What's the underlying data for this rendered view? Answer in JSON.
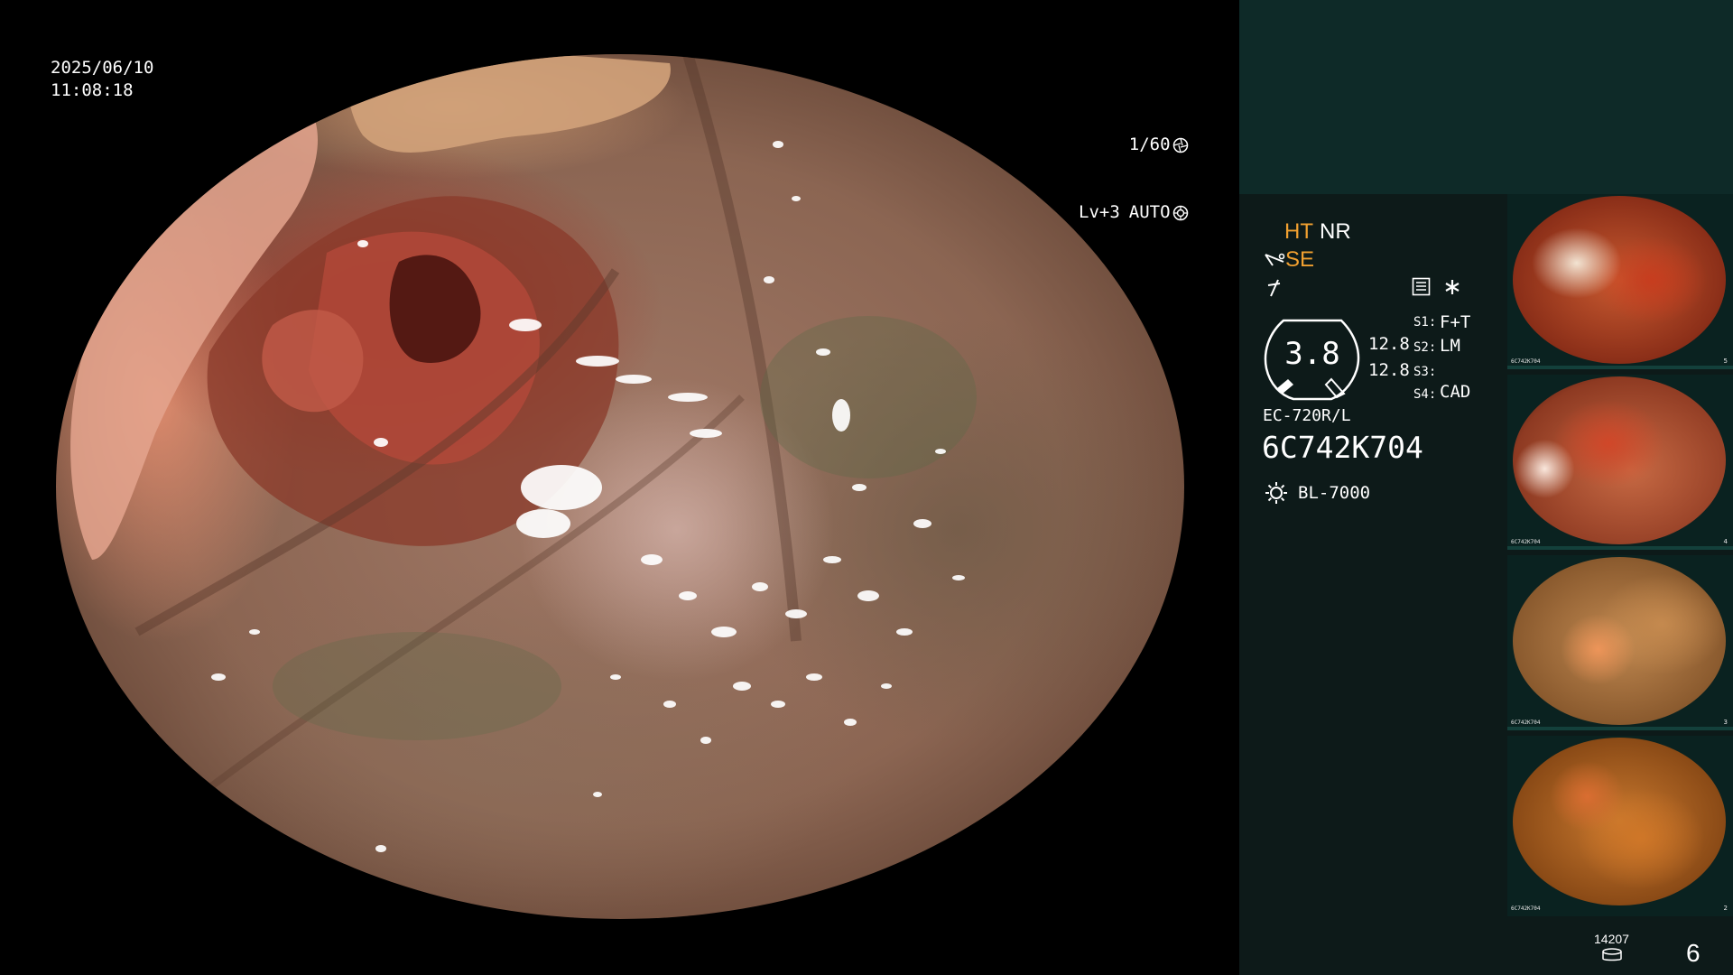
{
  "overlay": {
    "date": "2025/06/10",
    "time": "11:08:18",
    "shutter": "1/60",
    "level": "Lv+3",
    "mode": "AUTO"
  },
  "panel": {
    "ht": "HT",
    "nr": "NR",
    "se": "SE",
    "gauge_value": "3.8",
    "val1": "12.8",
    "val2": "12.8",
    "s1_label": "S1:",
    "s1_value": "F+T",
    "s2_label": "S2:",
    "s2_value": "LM",
    "s3_label": "S3:",
    "s3_value": "",
    "s4_label": "S4:",
    "s4_value": "CAD",
    "scope_model": "EC-720R/L",
    "scope_serial": "6C742K704",
    "light_source": "BL-7000",
    "image_count": "14207",
    "capture_number": "6"
  },
  "icons": {
    "shutter": "shutter-icon",
    "auto": "auto-iris-icon",
    "scissors": "scissors-icon",
    "lightning": "lightning-icon",
    "memo": "memo-icon",
    "asterisk": "asterisk-icon",
    "lamp": "lamp-icon",
    "disk": "disk-stack-icon"
  },
  "thumbnails": [
    {
      "serial": "6C742K704",
      "index": "5"
    },
    {
      "serial": "6C742K704",
      "index": "4"
    },
    {
      "serial": "6C742K704",
      "index": "3"
    },
    {
      "serial": "6C742K704",
      "index": "2"
    }
  ],
  "colors": {
    "accent_orange": "#f0a030",
    "panel_top": "#0e2a28",
    "panel_body": "#0d1a19"
  }
}
